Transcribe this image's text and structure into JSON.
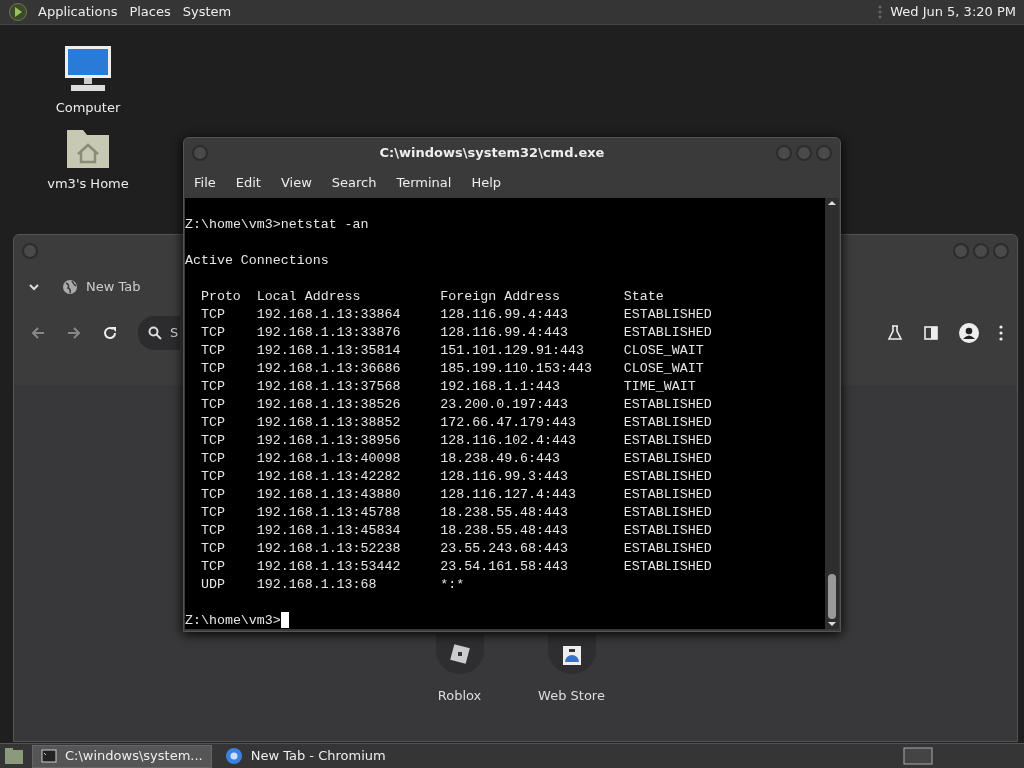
{
  "top_panel": {
    "menus": [
      "Applications",
      "Places",
      "System"
    ],
    "clock": "Wed Jun  5, 3:20 PM"
  },
  "desktop_icons": [
    {
      "label": "Computer",
      "kind": "computer"
    },
    {
      "label": "vm3's Home",
      "kind": "home"
    }
  ],
  "browser": {
    "tab": {
      "label": "New Tab"
    },
    "search": {
      "placeholder": "S"
    },
    "shortcuts": [
      {
        "label": "Roblox",
        "kind": "roblox"
      },
      {
        "label": "Web Store",
        "kind": "store"
      }
    ]
  },
  "terminal": {
    "title": "C:\\windows\\system32\\cmd.exe",
    "menu": [
      "File",
      "Edit",
      "View",
      "Search",
      "Terminal",
      "Help"
    ],
    "command": "Z:\\home\\vm3>netstat -an",
    "heading": "Active Connections",
    "columns": [
      "Proto",
      "Local Address",
      "Foreign Address",
      "State"
    ],
    "rows": [
      [
        "TCP",
        "192.168.1.13:33864",
        "128.116.99.4:443",
        "ESTABLISHED"
      ],
      [
        "TCP",
        "192.168.1.13:33876",
        "128.116.99.4:443",
        "ESTABLISHED"
      ],
      [
        "TCP",
        "192.168.1.13:35814",
        "151.101.129.91:443",
        "CLOSE_WAIT"
      ],
      [
        "TCP",
        "192.168.1.13:36686",
        "185.199.110.153:443",
        "CLOSE_WAIT"
      ],
      [
        "TCP",
        "192.168.1.13:37568",
        "192.168.1.1:443",
        "TIME_WAIT"
      ],
      [
        "TCP",
        "192.168.1.13:38526",
        "23.200.0.197:443",
        "ESTABLISHED"
      ],
      [
        "TCP",
        "192.168.1.13:38852",
        "172.66.47.179:443",
        "ESTABLISHED"
      ],
      [
        "TCP",
        "192.168.1.13:38956",
        "128.116.102.4:443",
        "ESTABLISHED"
      ],
      [
        "TCP",
        "192.168.1.13:40098",
        "18.238.49.6:443",
        "ESTABLISHED"
      ],
      [
        "TCP",
        "192.168.1.13:42282",
        "128.116.99.3:443",
        "ESTABLISHED"
      ],
      [
        "TCP",
        "192.168.1.13:43880",
        "128.116.127.4:443",
        "ESTABLISHED"
      ],
      [
        "TCP",
        "192.168.1.13:45788",
        "18.238.55.48:443",
        "ESTABLISHED"
      ],
      [
        "TCP",
        "192.168.1.13:45834",
        "18.238.55.48:443",
        "ESTABLISHED"
      ],
      [
        "TCP",
        "192.168.1.13:52238",
        "23.55.243.68:443",
        "ESTABLISHED"
      ],
      [
        "TCP",
        "192.168.1.13:53442",
        "23.54.161.58:443",
        "ESTABLISHED"
      ],
      [
        "UDP",
        "192.168.1.13:68",
        "*:*",
        ""
      ]
    ],
    "prompt": "Z:\\home\\vm3>"
  },
  "taskbar": [
    {
      "label": "C:\\windows\\system...",
      "kind": "terminal",
      "selected": true
    },
    {
      "label": "New Tab - Chromium",
      "kind": "browser",
      "selected": false
    }
  ]
}
